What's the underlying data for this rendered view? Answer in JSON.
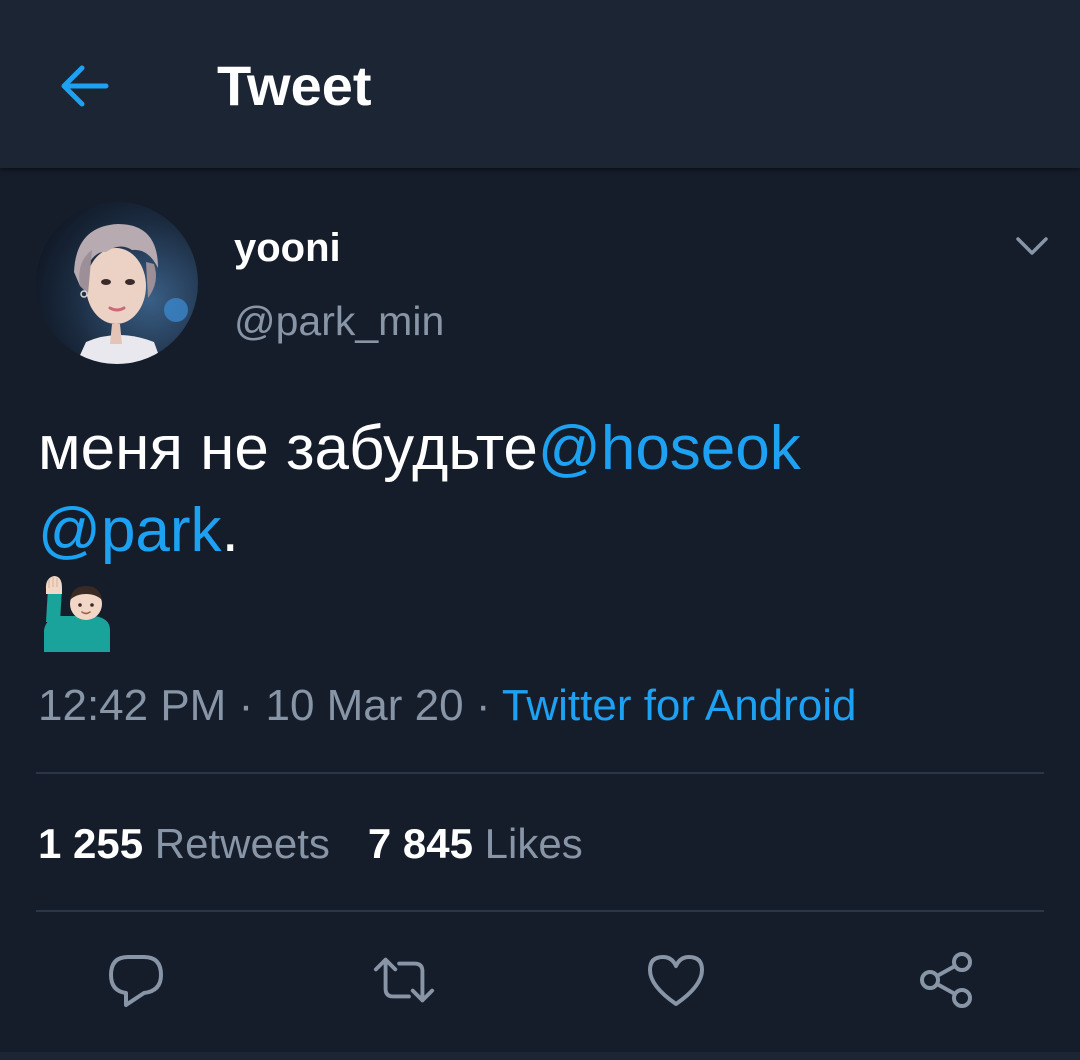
{
  "header": {
    "title": "Tweet",
    "back_icon": "arrow-left-icon"
  },
  "tweet": {
    "display_name": "yooni",
    "handle": "@park_min",
    "menu_icon": "chevron-down-icon",
    "text_part1": "меня не забудьте",
    "mention1": "@hoseok",
    "mention2": "@park",
    "text_part2": ".",
    "emoji": "🙋🏻‍♂️",
    "time": "12:42 PM",
    "separator": "·",
    "date": "10 Mar 20",
    "source": "Twitter for Android"
  },
  "stats": {
    "retweets_count": "1 255",
    "retweets_label": "Retweets",
    "likes_count": "7 845",
    "likes_label": "Likes"
  },
  "actions": {
    "reply_icon": "reply-icon",
    "retweet_icon": "retweet-icon",
    "like_icon": "heart-icon",
    "share_icon": "share-icon"
  },
  "colors": {
    "background": "#161d2a",
    "header_bg": "#1c2534",
    "accent": "#1da1f2",
    "muted": "#8795a6",
    "divider": "#2b3646"
  }
}
